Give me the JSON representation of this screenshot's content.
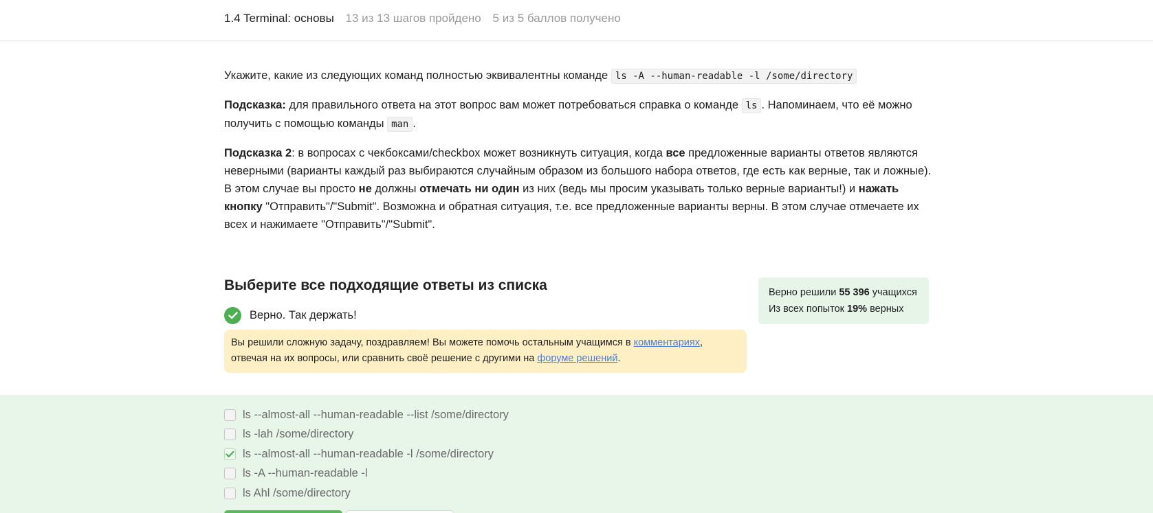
{
  "header": {
    "lesson_title": "1.4 Terminal: основы",
    "progress": "13 из 13 шагов пройдено",
    "score": "5 из 5 баллов  получено"
  },
  "step": {
    "p1": {
      "text": "Укажите, какие из следующих команд полностью эквивалентны команде ",
      "code": "ls -A --human-readable -l /some/directory"
    },
    "p2": {
      "bold": "Подсказка:",
      "text1": " для правильного ответа на этот вопрос вам может потребоваться справка о команде ",
      "code1": "ls",
      "text2": ". Напоминаем, что её можно получить с помощью команды ",
      "code2": "man",
      "text3": "."
    },
    "p3": {
      "b1": "Подсказка 2",
      "t1": ": в вопросах с чекбоксами/checkbox может возникнуть ситуация, когда ",
      "b2": "все",
      "t2": " предложенные варианты ответов являются неверными (варианты каждый раз выбираются случайным образом из большого набора ответов, где есть как верные, так и ложные). В этом случае вы просто ",
      "b3": "не",
      "t3": " должны ",
      "b4": "отмечать ни один",
      "t4": " из них (ведь мы просим указывать только верные варианты!) и ",
      "b5": "нажать кнопку",
      "t5": " \"Отправить\"/\"Submit\". Возможна и обратная ситуация, т.е. все предложенные варианты верны. В этом случае отмечаете их всех и нажимаете \"Отправить\"/\"Submit\"."
    }
  },
  "quiz": {
    "title": "Выберите все подходящие ответы из списка",
    "verdict": "Верно. Так держать!",
    "hint": {
      "t1": "Вы решили сложную задачу, поздравляем! Вы можете помочь остальным учащимся в ",
      "link1": "комментариях",
      "t2": ", отвечая на их вопросы, или сравнить своё решение с другими на ",
      "link2": "форуме решений",
      "t3": "."
    },
    "stats": {
      "line1_pre": "Верно решили ",
      "line1_num": "55 396",
      "line1_post": " учащихся",
      "line2_pre": "Из всех попыток ",
      "line2_num": "19%",
      "line2_post": " верных"
    },
    "options": [
      {
        "label": "ls --almost-all --human-readable --list /some/directory",
        "checked": false
      },
      {
        "label": "ls -lah /some/directory",
        "checked": false
      },
      {
        "label": "ls --almost-all --human-readable -l /some/directory",
        "checked": true
      },
      {
        "label": "ls -A --human-readable -l",
        "checked": false
      },
      {
        "label": "ls Ahl /some/directory",
        "checked": false
      }
    ]
  },
  "colors": {
    "success": "#4caf50",
    "answers_bg": "#e8f6ea",
    "hint_bg": "#ffefc4",
    "link": "#4a7fd4"
  }
}
